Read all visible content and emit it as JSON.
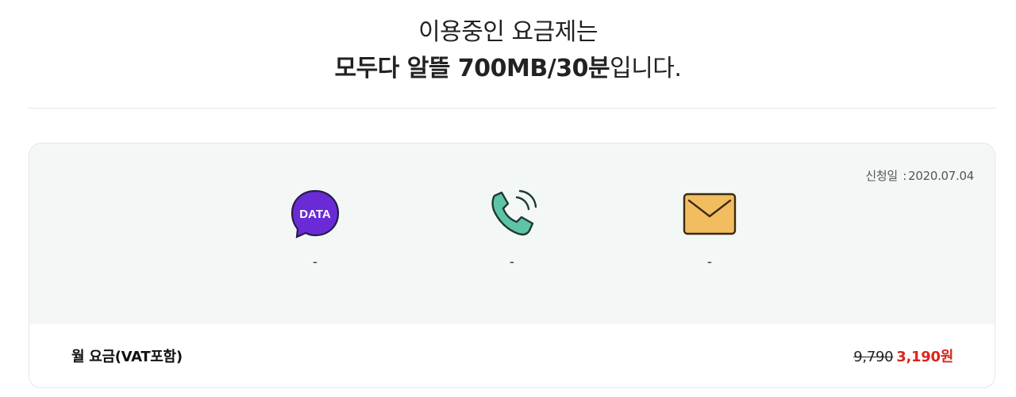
{
  "header": {
    "line1": "이용중인 요금제는",
    "plan_name": "모두다 알뜰 700MB/30분",
    "plan_suffix": "입니다."
  },
  "plan_card": {
    "apply_date_label": "신청일",
    "apply_date_sep": ":",
    "apply_date_value": "2020.07.04",
    "benefits": [
      {
        "icon": "data-bubble-icon",
        "icon_text": "DATA",
        "value": "-"
      },
      {
        "icon": "phone-call-icon",
        "value": "-"
      },
      {
        "icon": "envelope-icon",
        "value": "-"
      }
    ],
    "fee": {
      "label": "월 요금(VAT포함)",
      "original": "9,790",
      "discount": "3,190원"
    }
  },
  "colors": {
    "data_icon": "#6a2bd6",
    "phone_icon": "#5dc4a8",
    "envelope_icon": "#f2bd60",
    "discount_price": "#d8261c",
    "card_background": "#f3f8f7"
  }
}
